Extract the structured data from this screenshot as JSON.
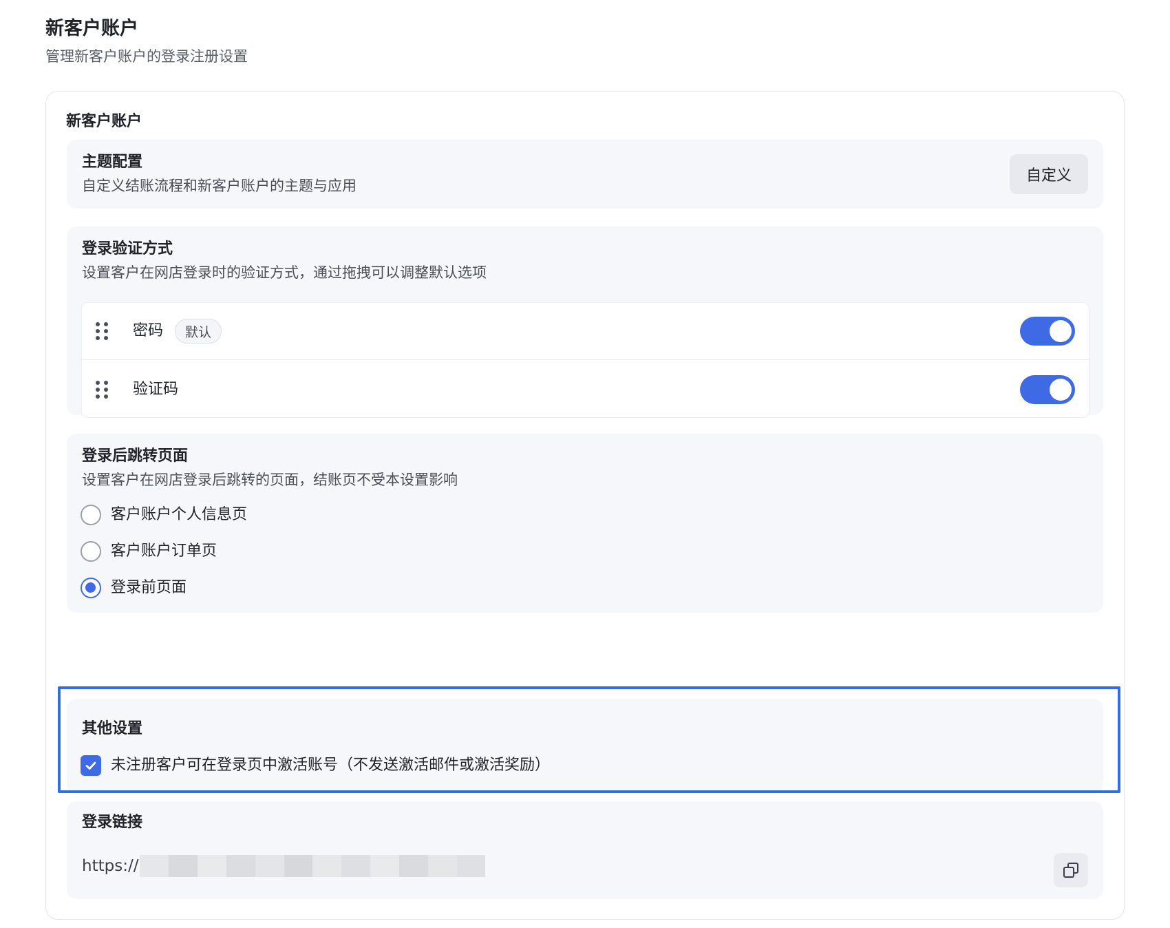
{
  "header": {
    "title": "新客户账户",
    "subtitle": "管理新客户账户的登录注册设置"
  },
  "card": {
    "title": "新客户账户"
  },
  "theme": {
    "title": "主题配置",
    "description": "自定义结账流程和新客户账户的主题与应用",
    "button_label": "自定义"
  },
  "login_methods": {
    "title": "登录验证方式",
    "description": "设置客户在网店登录时的验证方式，通过拖拽可以调整默认选项",
    "items": [
      {
        "label": "密码",
        "badge": "默认",
        "enabled": true
      },
      {
        "label": "验证码",
        "enabled": true
      }
    ]
  },
  "redirect": {
    "title": "登录后跳转页面",
    "description": "设置客户在网店登录后跳转的页面，结账页不受本设置影响",
    "options": [
      {
        "label": "客户账户个人信息页",
        "selected": false
      },
      {
        "label": "客户账户订单页",
        "selected": false
      },
      {
        "label": "登录前页面",
        "selected": true
      }
    ]
  },
  "other": {
    "title": "其他设置",
    "checkbox_label": "未注册客户可在登录页中激活账号（不发送激活邮件或激活奖励）",
    "checked": true
  },
  "login_link": {
    "title": "登录链接",
    "url_prefix": "https://"
  },
  "colors": {
    "accent": "#3e6be5",
    "highlight_border": "#2f6fe4",
    "section_bg": "#f6f7fb"
  },
  "icons": {
    "drag": "drag-handle-icon",
    "copy": "copy-icon",
    "check": "check-icon"
  }
}
